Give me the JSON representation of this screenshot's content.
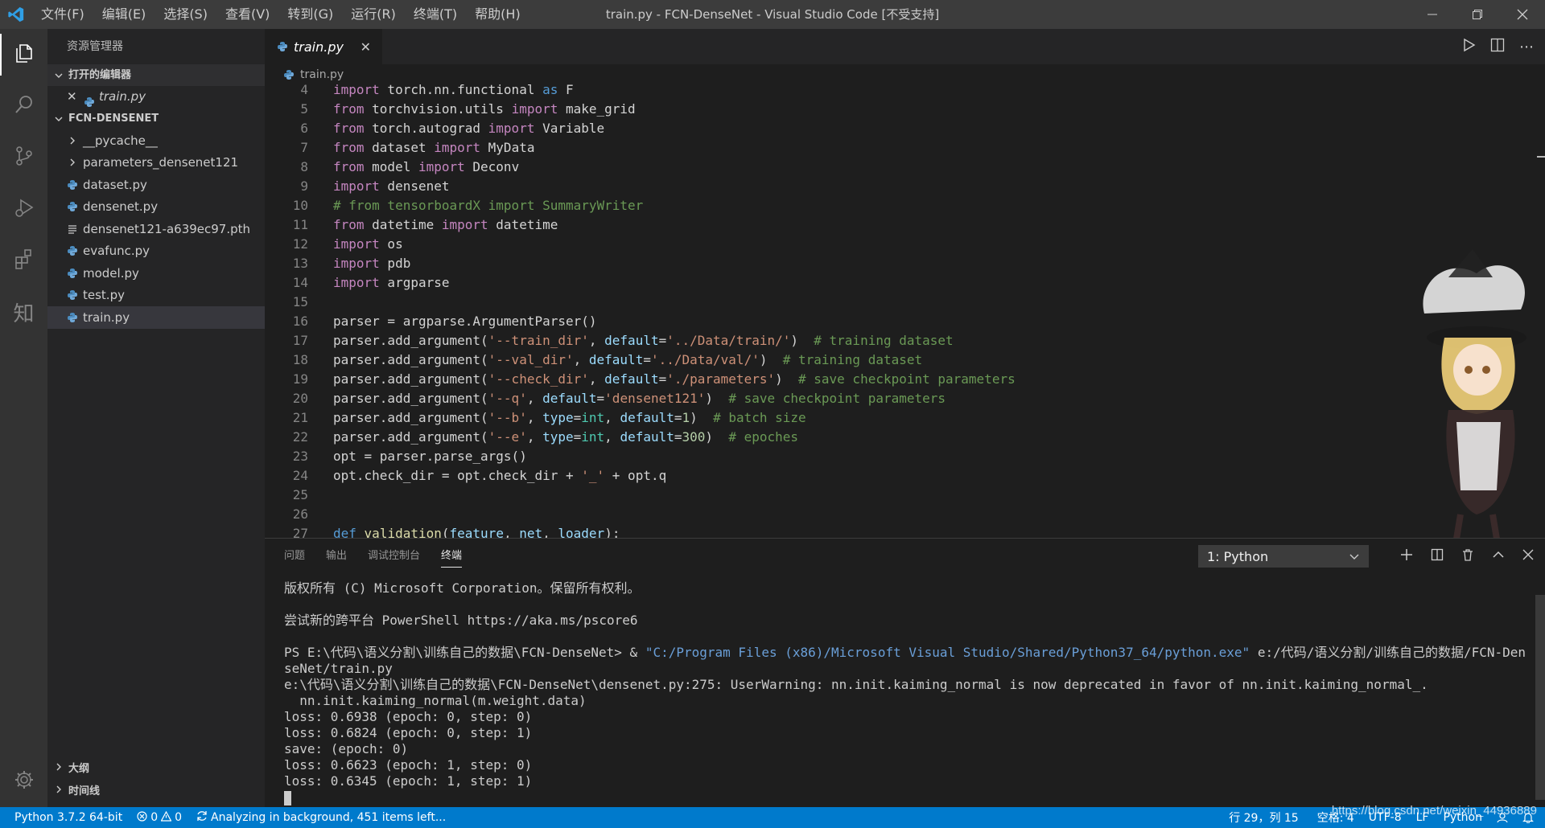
{
  "titlebar": {
    "menu": [
      "文件(F)",
      "编辑(E)",
      "选择(S)",
      "查看(V)",
      "转到(G)",
      "运行(R)",
      "终端(T)",
      "帮助(H)"
    ],
    "window_title": "train.py - FCN-DenseNet - Visual Studio Code [不受支持]"
  },
  "sidebar": {
    "header": "资源管理器",
    "open_editors_label": "打开的编辑器",
    "open_editor_file": "train.py",
    "folder_label": "FCN-DENSENET",
    "items": [
      {
        "label": "__pycache__",
        "kind": "folder"
      },
      {
        "label": "parameters_densenet121",
        "kind": "folder"
      },
      {
        "label": "dataset.py",
        "kind": "python"
      },
      {
        "label": "densenet.py",
        "kind": "python"
      },
      {
        "label": "densenet121-a639ec97.pth",
        "kind": "file"
      },
      {
        "label": "evafunc.py",
        "kind": "python"
      },
      {
        "label": "model.py",
        "kind": "python"
      },
      {
        "label": "test.py",
        "kind": "python"
      },
      {
        "label": "train.py",
        "kind": "python"
      }
    ],
    "outline_label": "大纲",
    "timeline_label": "时间线"
  },
  "editor": {
    "tab_label": "train.py",
    "breadcrumb": "train.py",
    "line_numbers": [
      "4",
      "5",
      "6",
      "7",
      "8",
      "9",
      "10",
      "11",
      "12",
      "13",
      "14",
      "15",
      "16",
      "17",
      "18",
      "19",
      "20",
      "21",
      "22",
      "23",
      "24",
      "25",
      "26",
      "27"
    ],
    "lines": {
      "l4": [
        "import",
        " torch.nn.functional ",
        "as",
        " F"
      ],
      "l5": [
        "from",
        " torchvision.utils ",
        "import",
        " make_grid"
      ],
      "l6": [
        "from",
        " torch.autograd ",
        "import",
        " Variable"
      ],
      "l7": [
        "from",
        " dataset ",
        "import",
        " MyData"
      ],
      "l8": [
        "from",
        " model ",
        "import",
        " Deconv"
      ],
      "l9": [
        "import",
        " densenet"
      ],
      "l10": "# from tensorboardX import SummaryWriter",
      "l11": [
        "from",
        " datetime ",
        "import",
        " datetime"
      ],
      "l12": [
        "import",
        " os"
      ],
      "l13": [
        "import",
        " pdb"
      ],
      "l14": [
        "import",
        " argparse"
      ],
      "l16": "parser = argparse.ArgumentParser()",
      "l17": [
        "parser.add_argument(",
        "'--train_dir'",
        ", ",
        "default",
        "=",
        "'../Data/train/'",
        ")  ",
        "# training dataset"
      ],
      "l18": [
        "parser.add_argument(",
        "'--val_dir'",
        ", ",
        "default",
        "=",
        "'../Data/val/'",
        ")  ",
        "# training dataset"
      ],
      "l19": [
        "parser.add_argument(",
        "'--check_dir'",
        ", ",
        "default",
        "=",
        "'./parameters'",
        ")  ",
        "# save checkpoint parameters"
      ],
      "l20": [
        "parser.add_argument(",
        "'--q'",
        ", ",
        "default",
        "=",
        "'densenet121'",
        ")  ",
        "# save checkpoint parameters"
      ],
      "l21": [
        "parser.add_argument(",
        "'--b'",
        ", ",
        "type",
        "=",
        "int",
        ", ",
        "default",
        "=",
        "1",
        ")  ",
        "# batch size"
      ],
      "l22": [
        "parser.add_argument(",
        "'--e'",
        ", ",
        "type",
        "=",
        "int",
        ", ",
        "default",
        "=",
        "300",
        ")  ",
        "# epoches"
      ],
      "l23": "opt = parser.parse_args()",
      "l24": [
        "opt.check_dir = opt.check_dir + ",
        "'_'",
        " + opt.q"
      ],
      "l27": [
        "def",
        " ",
        "validation",
        "(",
        "feature",
        ", ",
        "net",
        ", ",
        "loader",
        "):"
      ]
    }
  },
  "panel": {
    "tabs": [
      "问题",
      "输出",
      "调试控制台",
      "终端"
    ],
    "terminal_select": "1: Python",
    "terminal": {
      "copyright": "版权所有 (C) Microsoft Corporation。保留所有权利。",
      "tryit": "尝试新的跨平台 PowerShell https://aka.ms/pscore6",
      "prompt": "PS E:\\代码\\语义分割\\训练自己的数据\\FCN-DenseNet> & ",
      "python_path": "\"C:/Program Files (x86)/Microsoft Visual Studio/Shared/Python37_64/python.exe\"",
      "script_path": " e:/代码/语义分割/训练自己的数据/FCN-DenseNet/train.py",
      "warning": "e:\\代码\\语义分割\\训练自己的数据\\FCN-DenseNet\\densenet.py:275: UserWarning: nn.init.kaiming_normal is now deprecated in favor of nn.init.kaiming_normal_.",
      "warning2": "  nn.init.kaiming_normal(m.weight.data)",
      "out1": "loss: 0.6938 (epoch: 0, step: 0)",
      "out2": "loss: 0.6824 (epoch: 0, step: 1)",
      "out3": "save: (epoch: 0)",
      "out4": "loss: 0.6623 (epoch: 1, step: 0)",
      "out5": "loss: 0.6345 (epoch: 1, step: 1)"
    }
  },
  "statusbar": {
    "interpreter": "Python 3.7.2 64-bit",
    "errors": "0",
    "warnings": "0",
    "analyzing": "Analyzing in background, 451 items left...",
    "position": "行 29，列 15",
    "indent": "空格: 4",
    "encoding": "UTF-8",
    "eol": "LF",
    "language": "Python",
    "watermark": "https://blog.csdn.net/weixin_44936889"
  },
  "colors": {
    "accent": "#007acc",
    "keyword": "#c586c0",
    "string": "#ce9178",
    "comment": "#6a9955"
  }
}
